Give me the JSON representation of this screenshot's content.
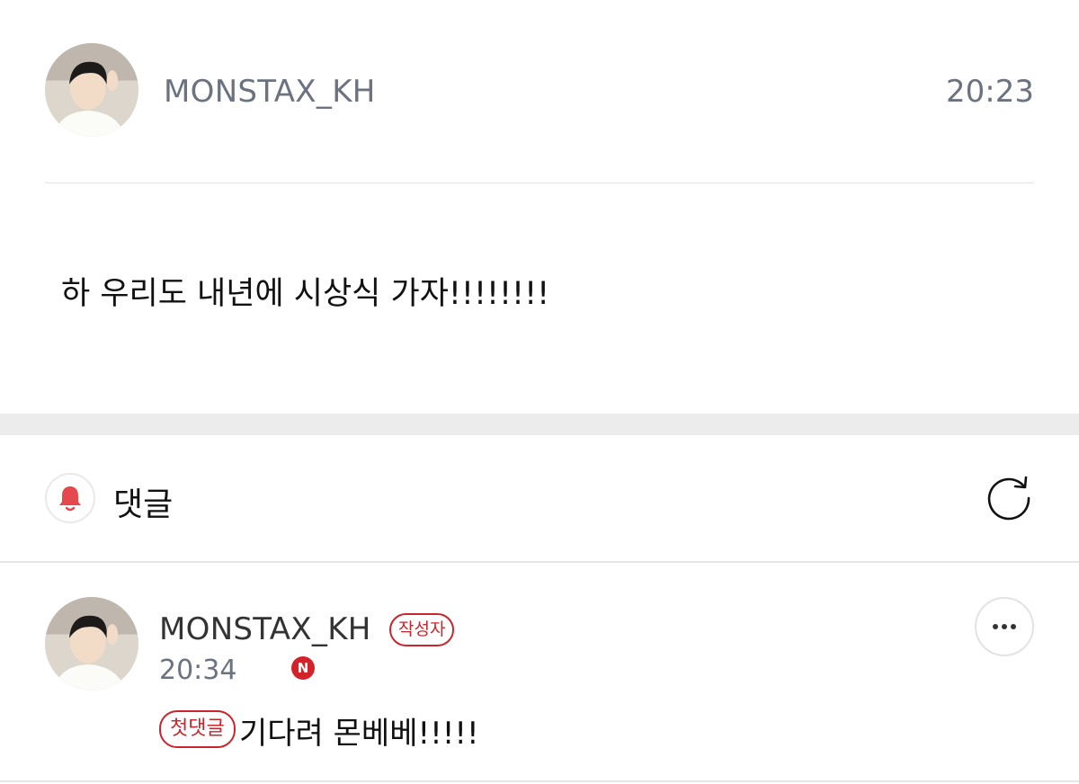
{
  "post": {
    "author": "MONSTAX_KH",
    "time": "20:23",
    "body": "하 우리도 내년에 시상식 가자!!!!!!!!"
  },
  "comments_header": {
    "title": "댓글",
    "bell_icon": "bell-icon",
    "refresh_icon": "refresh-icon",
    "accent_color": "#e5484d"
  },
  "comments": [
    {
      "author": "MONSTAX_KH",
      "author_badge": "작성자",
      "time": "20:34",
      "new_badge": "N",
      "first_comment_badge": "첫댓글",
      "text": "기다려 몬베베!!!!!",
      "more_icon": "more-options-icon"
    }
  ]
}
